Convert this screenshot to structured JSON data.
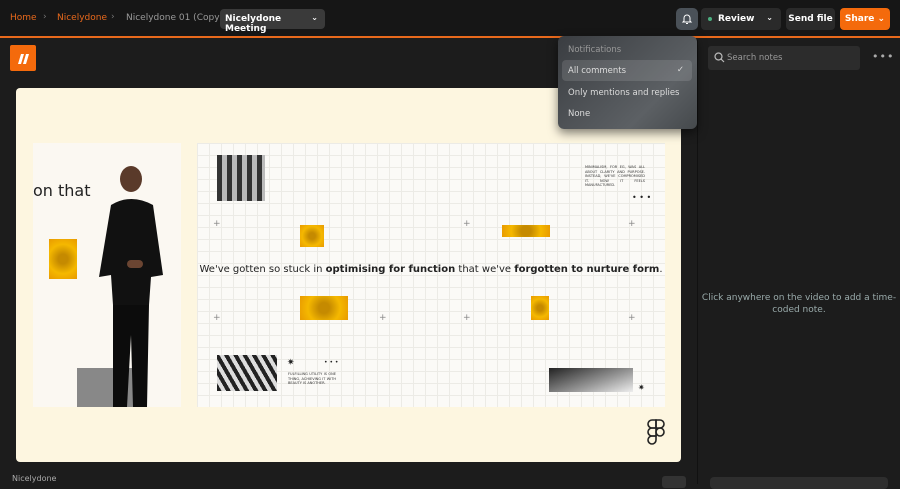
{
  "breadcrumb": {
    "items": [
      "Home",
      "Nicelydone",
      "Nicelydone 01 (Copy)"
    ],
    "current": "Nicelydone Meeting"
  },
  "toolbar": {
    "review_label": "Review",
    "send_label": "Send file",
    "share_label": "Share"
  },
  "notifications": {
    "title": "Notifications",
    "options": [
      "All comments",
      "Only mentions and replies",
      "None"
    ],
    "selected": "All comments"
  },
  "notes": {
    "search_placeholder": "Search notes",
    "empty_hint": "Click anywhere on the video to add a time-coded note."
  },
  "video": {
    "left_text": "on that",
    "quote_part1": "We've gotten so stuck in ",
    "quote_bold1": "optimising for function",
    "quote_part2": " that we've ",
    "quote_bold2": "forgotten to nurture form",
    "quote_end": ".",
    "text_top": "MINIMALISM, FOR EG, WAS ALL ABOUT CLARITY AND PURPOSE. INSTEAD, WE'VE COMPROMISED IT. NOW IT FEELS MANUFACTURED.",
    "text_bottom": "FULFILLING UTILITY IS ONE THING, ACHIEVING IT WITH BEAUTY IS ANOTHER."
  },
  "footer": {
    "owner": "Nicelydone"
  },
  "colors": {
    "accent": "#f46a0c",
    "cream": "#fdf6e0"
  }
}
